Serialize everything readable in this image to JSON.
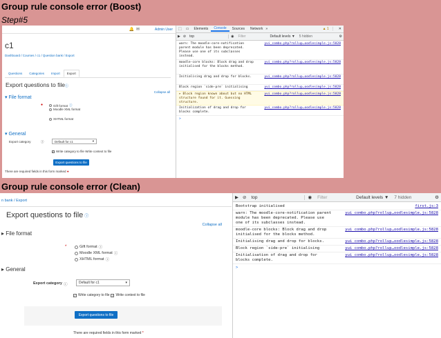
{
  "heading1": "Group rule console error (Boost)",
  "step": "Step#5",
  "heading2": "Group rule console error (Clean)",
  "boost": {
    "topbar": {
      "user": "Admin User"
    },
    "course_title": "c1",
    "breadcrumb": [
      "Dashboard",
      "Courses",
      "c1",
      "Question bank",
      "Export"
    ],
    "tabs": [
      "Questions",
      "Categories",
      "Import",
      "Export"
    ],
    "active_tab": "Export",
    "page_title": "Export questions to file",
    "collapse_all": "Collapse all",
    "file_format": "File format",
    "formats": [
      "Gift format",
      "Moodle XML format",
      "XHTML format"
    ],
    "general": "General",
    "export_category_label": "Export category",
    "export_category_value": "Default for c1",
    "write_label": "Write category to file",
    "write_context_label": "Write context to file",
    "submit": "Export questions to file",
    "required_note": "There are required fields in this form marked"
  },
  "clean": {
    "breadcrumb": [
      "n bank",
      "Export"
    ],
    "page_title": "Export questions to file",
    "collapse_all": "Collapse all",
    "file_format": "File format",
    "formats": [
      "Gift format",
      "Moodle XML format",
      "XHTML format"
    ],
    "general": "General",
    "export_category_label": "Export category",
    "export_category_value": "Default for c1",
    "write_label": "Write category to file",
    "write_context_label": "Write context to file",
    "submit": "Export questions to file",
    "required_note": "There are required fields in this form marked"
  },
  "devtools1": {
    "tabs": [
      "Elements",
      "Console",
      "Sources",
      "Network"
    ],
    "active_tab": "Console",
    "more": "»",
    "warn_count": "1",
    "context": "top",
    "filter_placeholder": "Filter",
    "levels": "Default levels ▼",
    "hidden": "5 hidden",
    "logs": [
      {
        "text": "warn: The moodle-core-notification parent module has been deprecated. Please use one of its subclasses instead.",
        "src": "yui_combo.php?rollup…oodlesimple.js:5828",
        "kind": "log"
      },
      {
        "text": "moodle-core blocks: Block drag and drop initialised for the blocks method.",
        "src": "yui_combo.php?rollup…oodlesimple.js:5828",
        "kind": "log"
      },
      {
        "text": "Initialising drag and drop for blocks.",
        "src": "yui_combo.php?rollup…oodlesimple.js:5828",
        "kind": "log"
      },
      {
        "text": "Block region `side-pre` initialising",
        "src": "yui_combo.php?rollup…oodlesimple.js:5828",
        "kind": "log"
      },
      {
        "text": "▸ Block region known about but no HTML structure found for it. Guessing structure.",
        "src": "yui_combo.php?rollup…oodlesimple.js:5828",
        "kind": "warn"
      },
      {
        "text": "Initialization of drag and drop for blocks complete.",
        "src": "yui_combo.php?rollup…oodlesimple.js:5828",
        "kind": "log"
      }
    ],
    "prompt": ">"
  },
  "devtools2": {
    "context": "top",
    "filter_placeholder": "Filter",
    "levels": "Default levels ▼",
    "hidden": "7 hidden",
    "logs": [
      {
        "text": "Bootstrap initialised",
        "src": "first.js:3",
        "kind": "log"
      },
      {
        "text": "warn: The moodle-core-notification parent module has been deprecated. Please use one of its subclasses instead.",
        "src": "yui_combo.php?rollup…oodlesimple.js:5828",
        "kind": "log"
      },
      {
        "text": "moodle-core blocks: Block drag and drop initialised for the blocks method.",
        "src": "yui_combo.php?rollup…oodlesimple.js:5828",
        "kind": "log"
      },
      {
        "text": "Initialising drag and drop for blocks.",
        "src": "yui_combo.php?rollup…oodlesimple.js:5828",
        "kind": "log"
      },
      {
        "text": "Block region `side-pre` initialising",
        "src": "yui_combo.php?rollup…oodlesimple.js:5828",
        "kind": "log"
      },
      {
        "text": "Initialisation of drag and drop for blocks complete.",
        "src": "yui_combo.php?rollup…oodlesimple.js:5828",
        "kind": "log"
      }
    ],
    "prompt": ">"
  }
}
